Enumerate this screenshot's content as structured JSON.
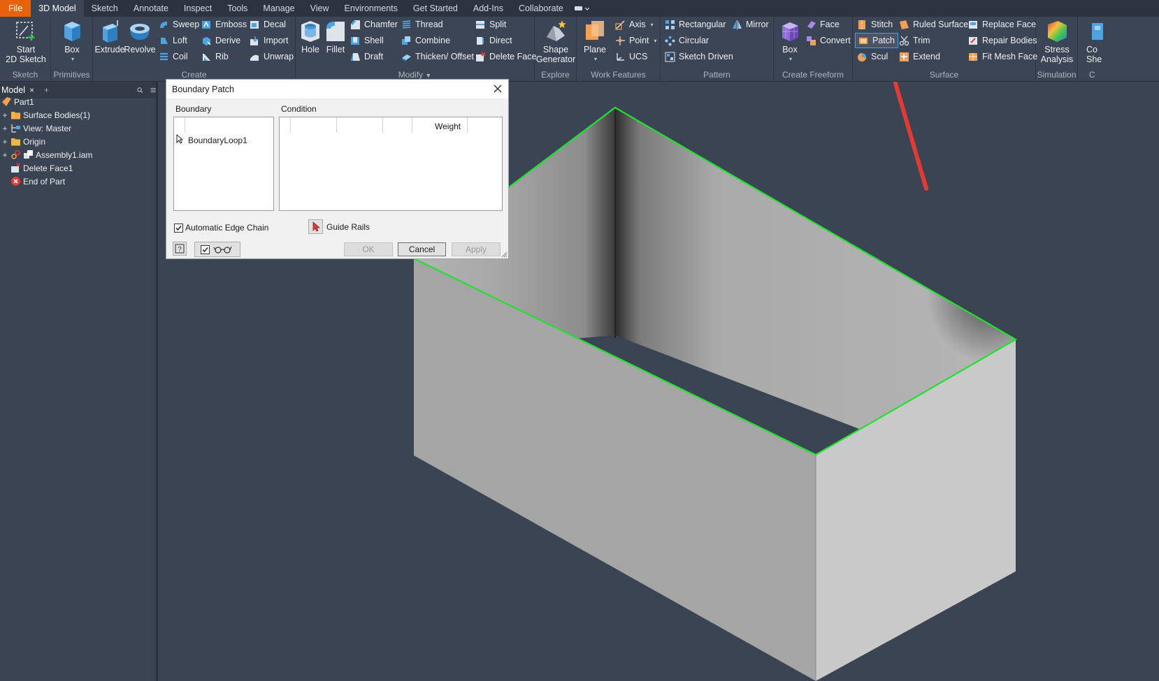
{
  "menu": {
    "tabs": [
      "File",
      "3D Model",
      "Sketch",
      "Annotate",
      "Inspect",
      "Tools",
      "Manage",
      "View",
      "Environments",
      "Get Started",
      "Add-Ins",
      "Collaborate"
    ]
  },
  "ribbon": {
    "sketch": {
      "start_line1": "Start",
      "start_line2": "2D Sketch",
      "label": "Sketch"
    },
    "primitives": {
      "box": "Box",
      "label": "Primitives"
    },
    "create": {
      "extrude": "Extrude",
      "revolve": "Revolve",
      "sweep": "Sweep",
      "loft": "Loft",
      "coil": "Coil",
      "emboss": "Emboss",
      "derive": "Derive",
      "rib": "Rib",
      "decal": "Decal",
      "import": "Import",
      "unwrap": "Unwrap",
      "label": "Create"
    },
    "modify": {
      "hole": "Hole",
      "fillet": "Fillet",
      "chamfer": "Chamfer",
      "shell": "Shell",
      "draft": "Draft",
      "thread": "Thread",
      "combine": "Combine",
      "thicken": "Thicken/ Offset",
      "split": "Split",
      "direct": "Direct",
      "delete_face": "Delete Face",
      "label": "Modify"
    },
    "explore": {
      "shape_line1": "Shape",
      "shape_line2": "Generator",
      "label": "Explore"
    },
    "work_features": {
      "plane": "Plane",
      "axis": "Axis",
      "point": "Point",
      "ucs": "UCS",
      "label": "Work Features"
    },
    "pattern": {
      "rectangular": "Rectangular",
      "circular": "Circular",
      "sketch_driven": "Sketch Driven",
      "mirror": "Mirror",
      "label": "Pattern"
    },
    "freeform": {
      "box": "Box",
      "face": "Face",
      "convert": "Convert",
      "label": "Create Freeform"
    },
    "surface": {
      "stitch": "Stitch",
      "patch": "Patch",
      "sculpt": "Scul",
      "ruled": "Ruled Surface",
      "trim": "Trim",
      "extend": "Extend",
      "replace_face": "Replace Face",
      "repair": "Repair Bodies",
      "fit_mesh": "Fit Mesh Face",
      "label": "Surface"
    },
    "simulation": {
      "stress_line1": "Stress",
      "stress_line2": "Analysis",
      "label": "Simulation"
    },
    "cut": {
      "line1": "Co",
      "line2": "She",
      "label": "C"
    }
  },
  "browser": {
    "title": "Model",
    "tree": [
      {
        "label": "Part1"
      },
      {
        "label": "Surface Bodies(1)"
      },
      {
        "label": "View: Master"
      },
      {
        "label": "Origin"
      },
      {
        "label": "Assembly1.iam"
      },
      {
        "label": "Delete Face1"
      },
      {
        "label": "End of Part"
      }
    ]
  },
  "dialog": {
    "title": "Boundary Patch",
    "boundary_header": "Boundary",
    "condition_header": "Condition",
    "boundary_item": "BoundaryLoop1",
    "weight_col": "Weight",
    "auto_edge_chain": "Automatic Edge Chain",
    "auto_edge_chain_checked": true,
    "guide_rails": "Guide Rails",
    "ok": "OK",
    "cancel": "Cancel",
    "apply": "Apply"
  },
  "colors": {
    "accent_file": "#e8610c",
    "selection_edge": "#22e030",
    "annotation_arrow": "#e23a35"
  }
}
